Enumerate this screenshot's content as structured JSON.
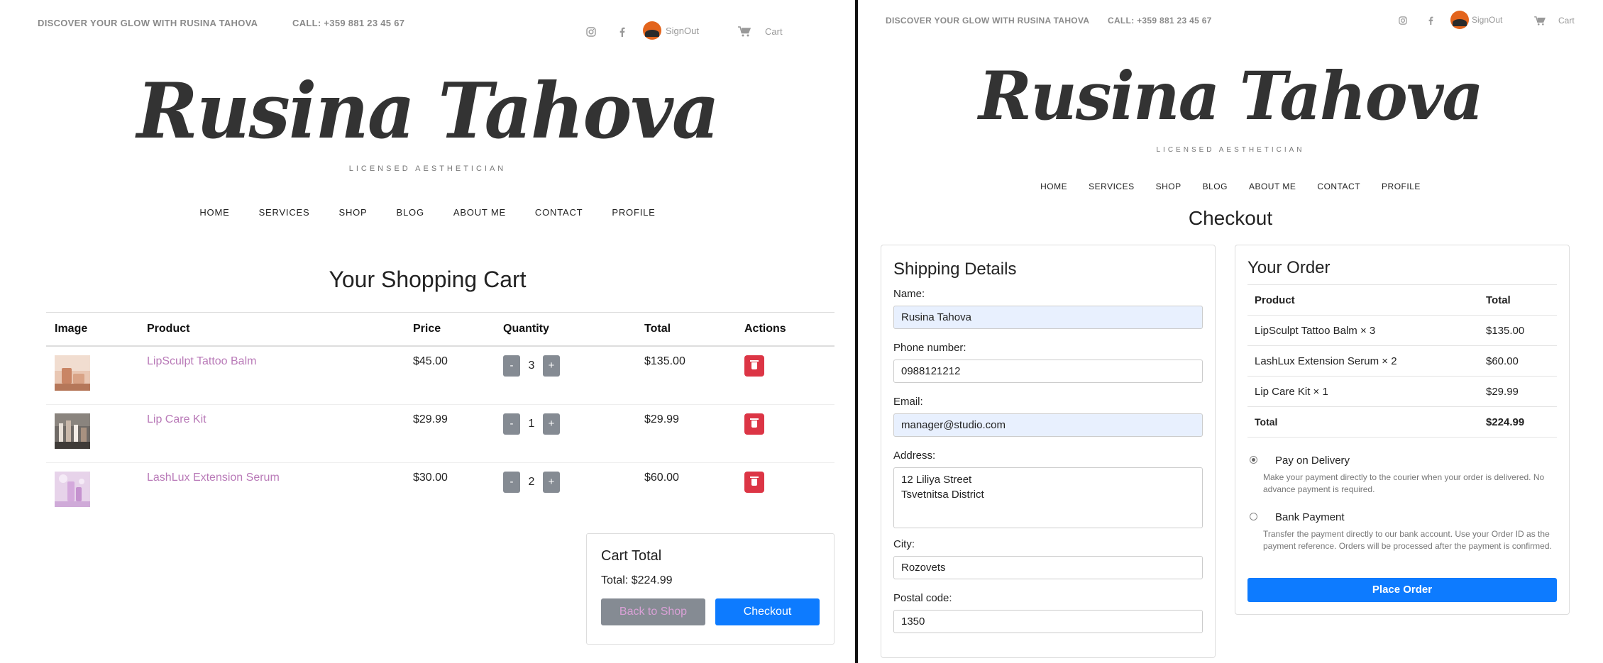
{
  "header": {
    "tagline_text": "DISCOVER YOUR GLOW WITH RUSINA TAHOVA",
    "phone_text": "CALL: +359 881 23 45 67",
    "signout_label": "SignOut",
    "cart_label": "Cart"
  },
  "brand": {
    "name": "Rusina Tahova",
    "subtitle": "LICENSED AESTHETICIAN"
  },
  "nav": [
    "HOME",
    "SERVICES",
    "SHOP",
    "BLOG",
    "ABOUT ME",
    "CONTACT",
    "PROFILE"
  ],
  "cart": {
    "title": "Your Shopping Cart",
    "columns": [
      "Image",
      "Product",
      "Price",
      "Quantity",
      "Total",
      "Actions"
    ],
    "items": [
      {
        "product": "LipSculpt Tattoo Balm",
        "price": "$45.00",
        "quantity": "3",
        "total": "$135.00"
      },
      {
        "product": "Lip Care Kit",
        "price": "$29.99",
        "quantity": "1",
        "total": "$29.99"
      },
      {
        "product": "LashLux Extension Serum",
        "price": "$30.00",
        "quantity": "2",
        "total": "$60.00"
      }
    ],
    "minus_label": "-",
    "plus_label": "+",
    "summary": {
      "title": "Cart Total",
      "total_text": "Total: $224.99",
      "back_label": "Back to Shop",
      "checkout_label": "Checkout"
    }
  },
  "checkout": {
    "title": "Checkout",
    "shipping": {
      "title": "Shipping Details",
      "name_label": "Name:",
      "name_value": "Rusina Tahova",
      "phone_label": "Phone number:",
      "phone_value": "0988121212",
      "email_label": "Email:",
      "email_value": "manager@studio.com",
      "address_label": "Address:",
      "address_line1": "12 Liliya Street",
      "address_line2": "Tsvetnitsa District",
      "city_label": "City:",
      "city_value": "Rozovets",
      "postal_label": "Postal code:",
      "postal_value": "1350"
    },
    "order": {
      "title": "Your Order",
      "columns": [
        "Product",
        "Total"
      ],
      "rows": [
        {
          "product": "LipSculpt Tattoo Balm × 3",
          "total": "$135.00"
        },
        {
          "product": "LashLux Extension Serum × 2",
          "total": "$60.00"
        },
        {
          "product": "Lip Care Kit × 1",
          "total": "$29.99"
        }
      ],
      "total_label": "Total",
      "total_value": "$224.99",
      "payment": {
        "cod_title": "Pay on Delivery",
        "cod_desc": "Make your payment directly to the courier when your order is delivered. No advance payment is required.",
        "bank_title": "Bank Payment",
        "bank_desc": "Transfer the payment directly to our bank account. Use your Order ID as the payment reference. Orders will be processed after the payment is confirmed.",
        "selected": "Pay on Delivery"
      },
      "place_order_label": "Place Order"
    }
  },
  "colors": {
    "primary": "#0d7bff",
    "secondary": "#858b93",
    "danger": "#dc3545",
    "product_link": "#b97ab8"
  }
}
